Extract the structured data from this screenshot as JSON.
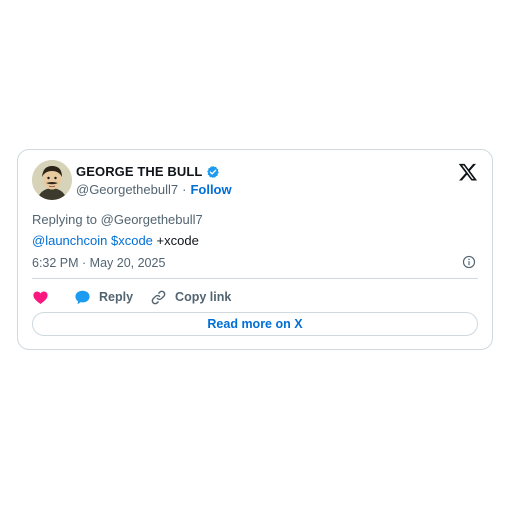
{
  "author": {
    "display_name": "GEORGE THE BULL",
    "handle": "@Georgethebull7",
    "separator": "·",
    "follow_label": "Follow"
  },
  "tweet": {
    "replying_to": "Replying to @Georgethebull7",
    "mention": "@launchcoin",
    "cashtag": "$xcode",
    "tail_text": " +xcode",
    "timestamp": "6:32 PM · May 20, 2025"
  },
  "actions": {
    "reply_label": "Reply",
    "copy_link_label": "Copy link"
  },
  "footer": {
    "read_more_label": "Read more on X"
  },
  "icons": {
    "verified": "verified-badge-icon",
    "x_logo": "x-logo-icon",
    "info": "info-icon",
    "heart": "heart-icon",
    "reply": "speech-bubble-icon",
    "link": "chain-link-icon"
  },
  "colors": {
    "link": "#006fd6",
    "heart": "#f91880",
    "verified": "#1d9bf0",
    "reply_bubble": "#1d9bf0",
    "border": "#cfd9de",
    "secondary_text": "#536471"
  }
}
